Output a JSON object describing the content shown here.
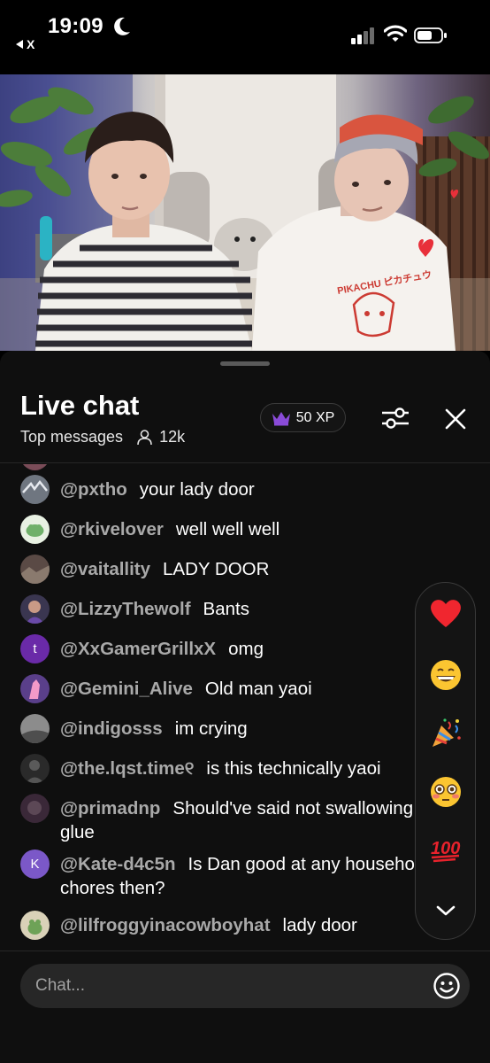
{
  "status_bar": {
    "time": "19:09",
    "back_label": "X"
  },
  "chat": {
    "title": "Live chat",
    "sort_label": "Top messages",
    "viewer_count": "12k",
    "xp_label": "50 XP"
  },
  "messages": [
    {
      "user": "@pxtho",
      "text": "your lady door",
      "avatar_color": "#6f7680",
      "avatar_letter": ""
    },
    {
      "user": "@rkivelover",
      "text": "well well well",
      "avatar_color": "#e8f1e3",
      "avatar_letter": ""
    },
    {
      "user": "@vaitallity",
      "text": "LADY DOOR",
      "avatar_color": "#5a4a45",
      "avatar_letter": ""
    },
    {
      "user": "@LizzyThewolf",
      "text": "Bants",
      "avatar_color": "#3a3650",
      "avatar_letter": ""
    },
    {
      "user": "@XxGamerGrillxX",
      "text": "omg",
      "avatar_color": "#6a2aa8",
      "avatar_letter": "t"
    },
    {
      "user": "@Gemini_Alive",
      "text": "Old man yaoi",
      "avatar_color": "#5a3f8a",
      "avatar_letter": ""
    },
    {
      "user": "@indigosss",
      "text": "im crying",
      "avatar_color": "#8c8c8c",
      "avatar_letter": ""
    },
    {
      "user": "@the.lqst.time୧",
      "text": "is this technically yaoi",
      "avatar_color": "#2a2a2a",
      "avatar_letter": ""
    },
    {
      "user": "@primadnp",
      "text": "Should've said not swallowing glue",
      "avatar_color": "#3a2838",
      "avatar_letter": ""
    },
    {
      "user": "@Kate-d4c5n",
      "text": "Is Dan good at any household chores then?",
      "avatar_color": "#7b58c8",
      "avatar_letter": "K"
    },
    {
      "user": "@lilfroggyinacowboyhat",
      "text": "lady door",
      "avatar_color": "#d9d1b8",
      "avatar_letter": ""
    }
  ],
  "reactions": [
    "heart",
    "grin",
    "party-popper",
    "flushed",
    "hundred"
  ],
  "input": {
    "placeholder": "Chat..."
  },
  "colors": {
    "username": "#a9a9a9",
    "panel_bg": "#0f0f0f",
    "input_bg": "#272727",
    "crown": "#8a4bd8"
  }
}
